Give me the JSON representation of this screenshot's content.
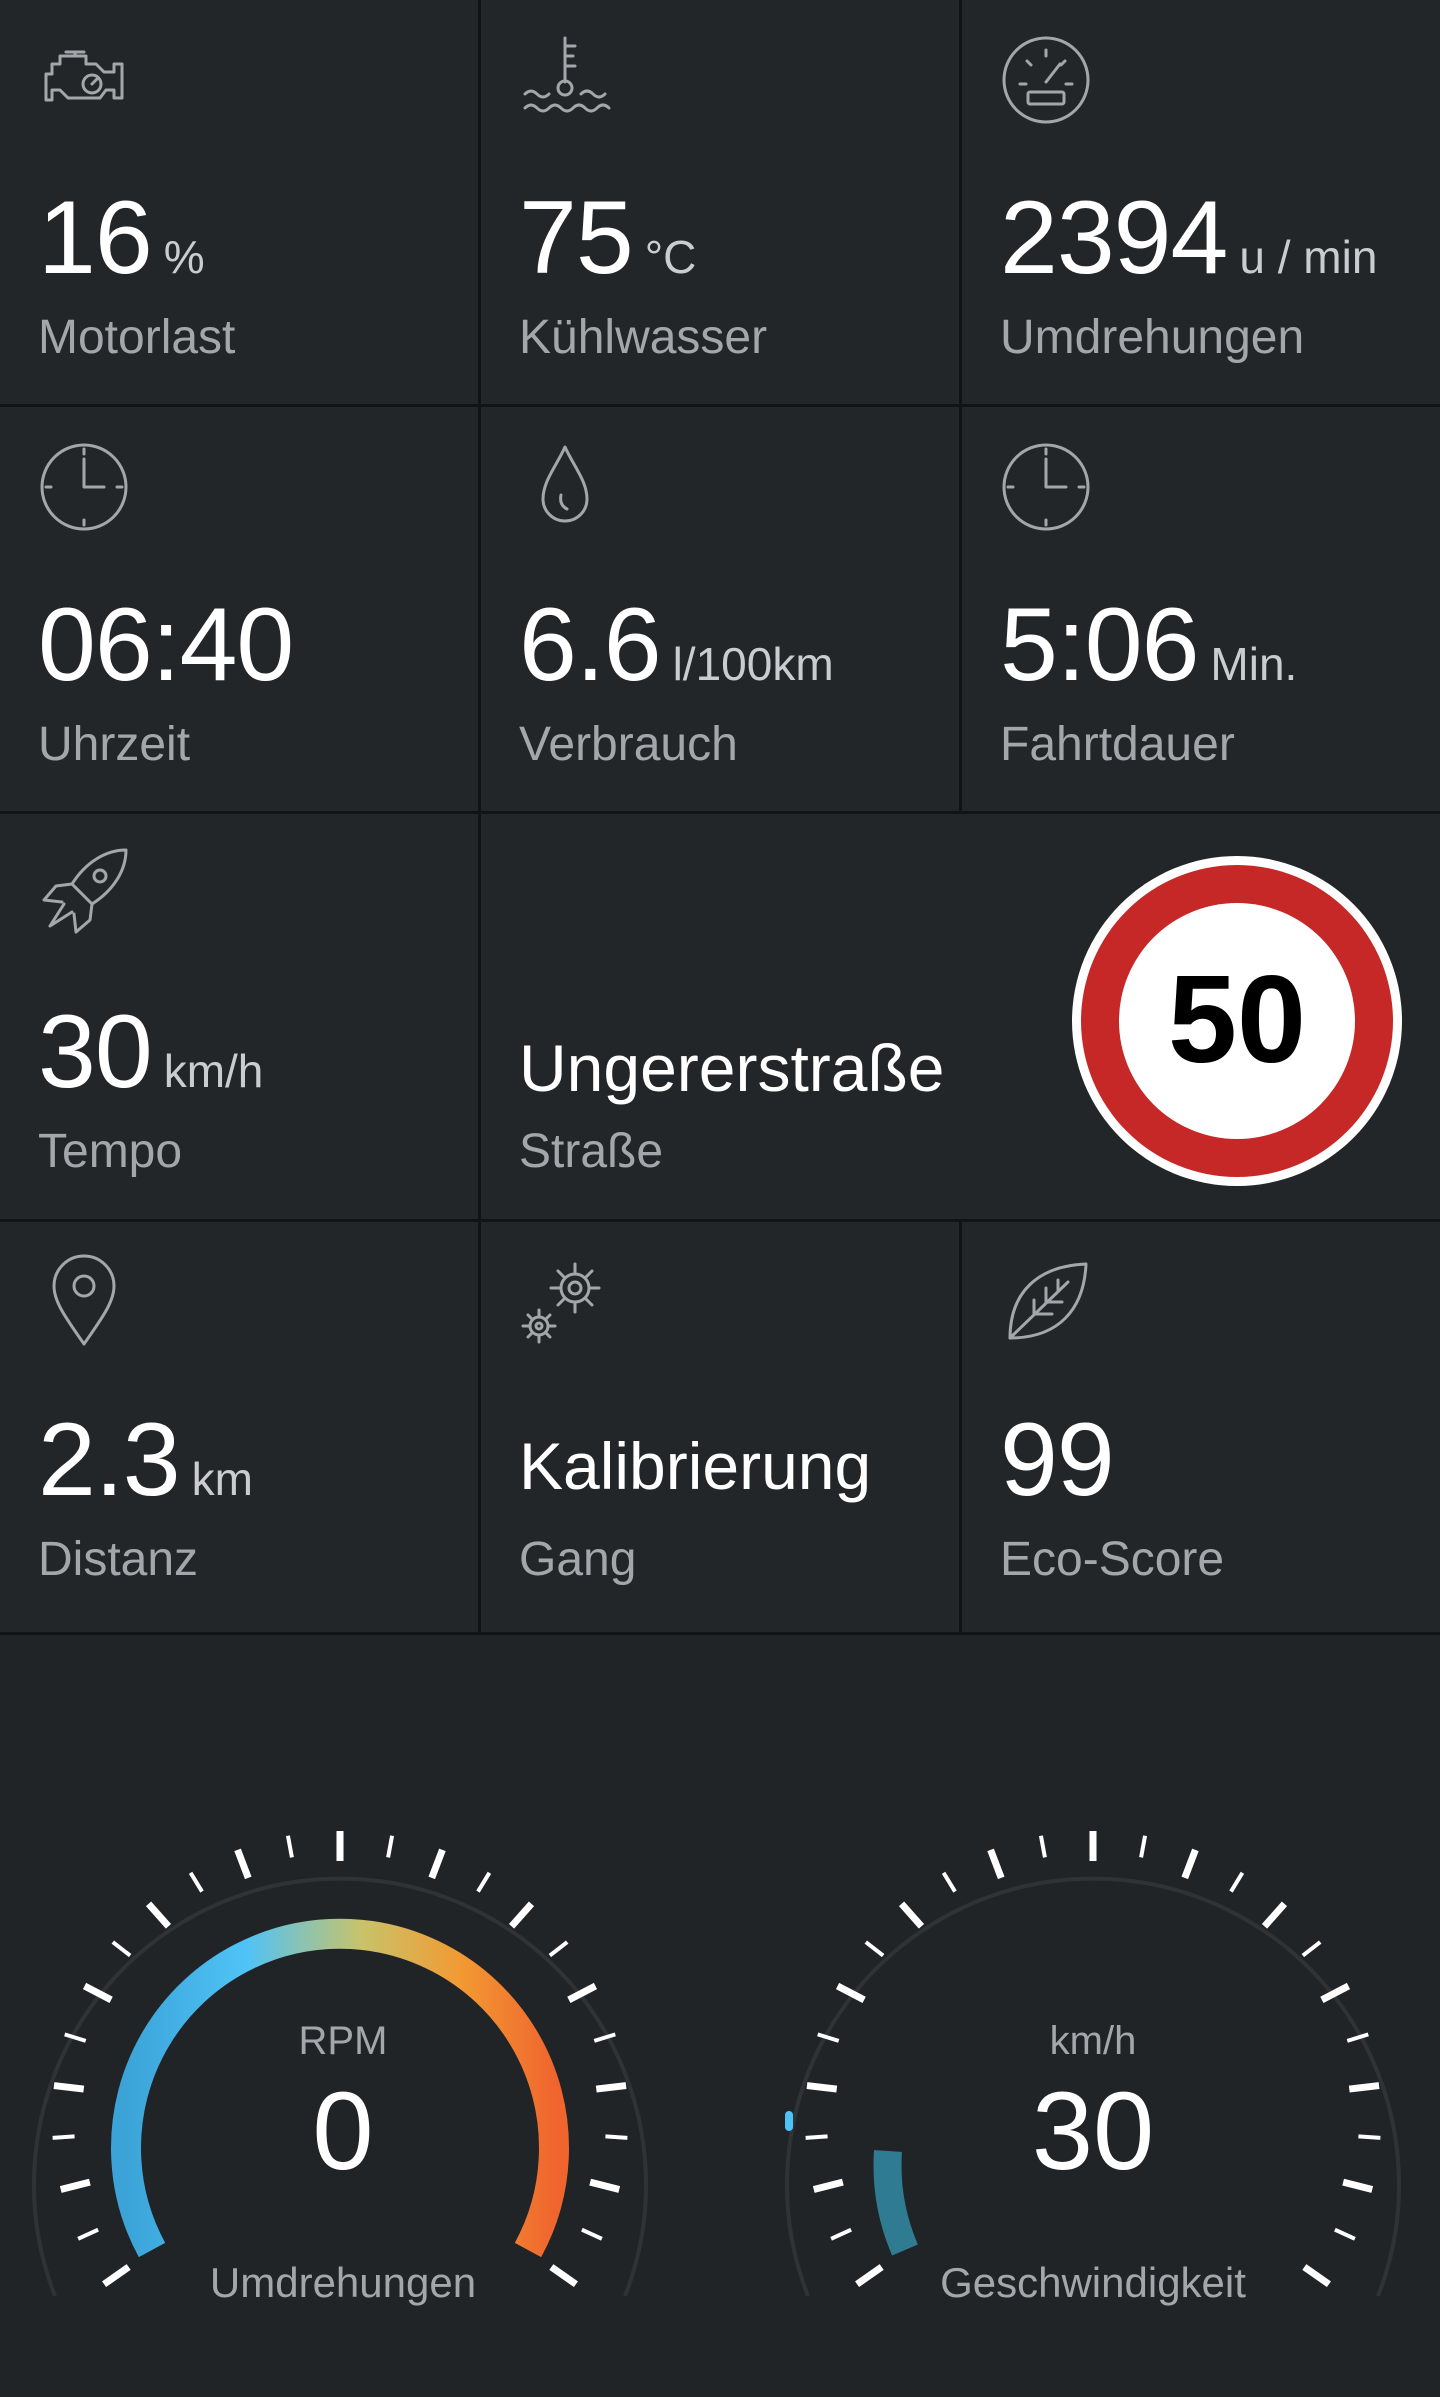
{
  "tiles": {
    "engine_load": {
      "value": "16",
      "unit": "%",
      "label": "Motorlast"
    },
    "coolant": {
      "value": "75",
      "unit": "°C",
      "label": "Kühlwasser"
    },
    "rpm": {
      "value": "2394",
      "unit": "u / min",
      "label": "Umdrehungen"
    },
    "clock": {
      "value": "06:40",
      "unit": "",
      "label": "Uhrzeit"
    },
    "consumption": {
      "value": "6.6",
      "unit": "l/100km",
      "label": "Verbrauch"
    },
    "trip_time": {
      "value": "5:06",
      "unit": "Min.",
      "label": "Fahrtdauer"
    },
    "speed": {
      "value": "30",
      "unit": "km/h",
      "label": "Tempo"
    },
    "street": {
      "value": "Ungererstraße",
      "label": "Straße"
    },
    "speed_limit": {
      "value": "50"
    },
    "distance": {
      "value": "2.3",
      "unit": "km",
      "label": "Distanz"
    },
    "gear": {
      "value": "Kalibrierung",
      "label": "Gang"
    },
    "eco": {
      "value": "99",
      "unit": "",
      "label": "Eco-Score"
    }
  },
  "gauges": {
    "rpm": {
      "title": "RPM",
      "value": "0",
      "caption": "Umdrehungen"
    },
    "speed": {
      "title": "km/h",
      "value": "30",
      "caption": "Geschwindigkeit"
    }
  },
  "colors": {
    "background": "#212427",
    "divider": "#111315",
    "label": "#a3a7ac",
    "sign_red": "#c62828",
    "gauge_blue": "#4fc3f7",
    "gauge_orange": "#f0652e",
    "speed_arc": "#2f8aa3"
  },
  "icons": {
    "engine_load": "engine-icon",
    "coolant": "thermometer-water-icon",
    "rpm": "speedometer-icon",
    "clock": "clock-icon",
    "consumption": "drop-icon",
    "trip_time": "clock-icon",
    "speed": "rocket-icon",
    "distance": "map-pin-icon",
    "gear": "gears-icon",
    "eco": "leaf-icon"
  }
}
